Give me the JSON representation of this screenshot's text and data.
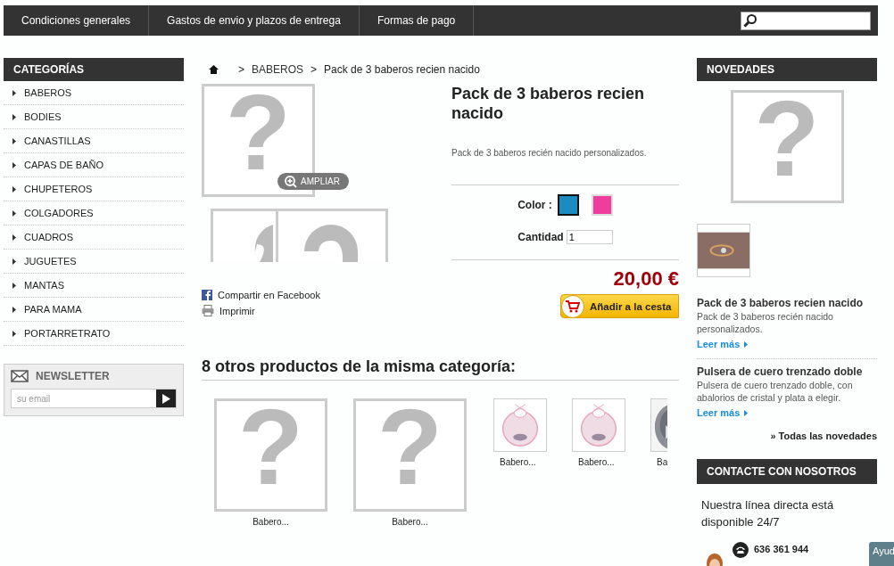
{
  "top_nav": {
    "links": [
      "Condiciones generales",
      "Gastos de envio y plazos de entrega",
      "Formas de pago"
    ]
  },
  "categories": {
    "title": "CATEGORÍAS",
    "items": [
      "BABEROS",
      "BODIES",
      "CANASTILLAS",
      "CAPAS DE BAÑO",
      "CHUPETEROS",
      "COLGADORES",
      "CUADROS",
      "JUGUETES",
      "MANTAS",
      "PARA MAMA",
      "PORTARRETRATO"
    ]
  },
  "newsletter": {
    "title": "NEWSLETTER",
    "placeholder": "su email"
  },
  "breadcrumb": {
    "separator": ">",
    "items": [
      "BABEROS",
      "Pack de 3 baberos recien nacido"
    ]
  },
  "product": {
    "glyph": "?",
    "zoom_label": "AMPLIAR",
    "thumbnails": [
      {
        "kind": "placeholder"
      },
      {
        "kind": "placeholder"
      }
    ],
    "title": "Pack de 3 baberos recien nacido",
    "description": "Pack de 3 baberos recién nacido personalizados.",
    "color_label": "Color :",
    "colors": [
      {
        "color": "#1a8cc0",
        "selected": true
      },
      {
        "color": "#f03c9c",
        "selected": false
      }
    ],
    "quantity_label": "Cantidad",
    "quantity": "1",
    "price": "20,00 €",
    "add_to_cart": "Añadir a la cesta",
    "share": "Compartir en Facebook",
    "print": "Imprimir"
  },
  "related": {
    "title": "8 otros productos de la misma categoría:",
    "items": [
      {
        "kind": "placeholder",
        "label": "Babero..."
      },
      {
        "kind": "placeholder",
        "label": "Babero..."
      },
      {
        "kind": "picture",
        "label": "Babero..."
      },
      {
        "kind": "picture",
        "label": "Babero..."
      },
      {
        "kind": "picture",
        "label": "Ba"
      }
    ]
  },
  "novedades": {
    "title": "NOVEDADES",
    "items": [
      {
        "title": "Pack de 3 baberos recien nacido",
        "text": "Pack de 3 baberos recién nacido personalizados.",
        "link": "Leer más"
      },
      {
        "title": "Pulsera de cuero trenzado doble",
        "text": "Pulsera de cuero trenzado doble, con abalorios de cristal y plata a elegir.",
        "link": "Leer más"
      }
    ],
    "all_link": "» Todas las novedades"
  },
  "contact": {
    "title": "CONTACTE CON NOSOTROS",
    "text": "Nuestra línea directa está disponible 24/7",
    "phone": "636 361 944"
  },
  "help_tab": "Ayud"
}
